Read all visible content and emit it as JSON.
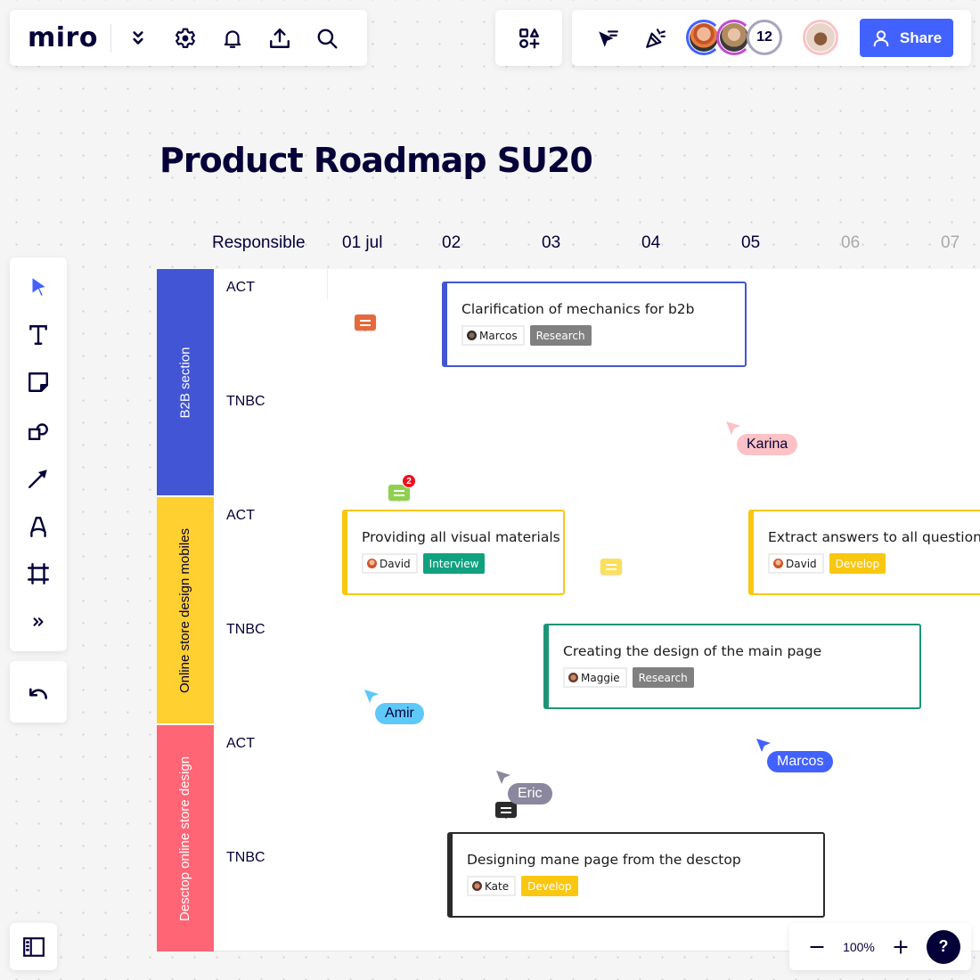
{
  "app": {
    "logo": "miro"
  },
  "topbar": {
    "left_icons": [
      "chevron-double-down-icon",
      "gear-icon",
      "bell-icon",
      "upload-icon",
      "search-icon"
    ],
    "apps_icon": "shapes-plus-icon",
    "collab_icons": [
      "cursor-filter-icon",
      "celebration-icon"
    ],
    "participants_extra_count": "12",
    "share_label": "Share",
    "colors": {
      "share": "#4262ff",
      "avatar1_ring": "#4262ff",
      "avatar2_ring": "#c14bd1",
      "count_ring": "#a7a4bd",
      "me_ring": "#fcc2c5"
    }
  },
  "toolbar": {
    "tools": [
      {
        "name": "select-tool",
        "icon": "pointer-icon"
      },
      {
        "name": "text-tool",
        "icon": "text-icon"
      },
      {
        "name": "sticky-note-tool",
        "icon": "sticky-note-icon"
      },
      {
        "name": "shapes-tool",
        "icon": "shapes-icon"
      },
      {
        "name": "arrow-tool",
        "icon": "arrow-icon"
      },
      {
        "name": "pen-tool",
        "icon": "pen-icon"
      },
      {
        "name": "frame-tool",
        "icon": "frame-icon"
      },
      {
        "name": "more-tools",
        "icon": "chevrons-right-icon"
      }
    ],
    "undo_icon": "undo-icon"
  },
  "board": {
    "title": "Product Roadmap SU20",
    "columns": [
      {
        "label": "Responsible",
        "muted": false
      },
      {
        "label": "01 jul",
        "muted": false
      },
      {
        "label": "02",
        "muted": false
      },
      {
        "label": "03",
        "muted": false
      },
      {
        "label": "04",
        "muted": false
      },
      {
        "label": "05",
        "muted": false
      },
      {
        "label": "06",
        "muted": true
      },
      {
        "label": "07",
        "muted": true
      }
    ],
    "sections": [
      {
        "label": "B2B section",
        "color": "#4255d4",
        "text_color": "#ffffff",
        "rows": [
          "ACT",
          "TNBC"
        ]
      },
      {
        "label": "Online store design mobiles",
        "color": "#ffd02f",
        "text_color": "#050038",
        "rows": [
          "ACT",
          "TNBC"
        ]
      },
      {
        "label": "Desctop online store design",
        "color": "#ff6575",
        "text_color": "#ffffff",
        "rows": [
          "ACT",
          "TNBC"
        ]
      }
    ],
    "cards": [
      {
        "title": "Clarification of mechanics for b2b",
        "person": "Marcos",
        "status": "Research",
        "border": "#4255d4",
        "status_color": "#808080"
      },
      {
        "title": "Providing all visual materials",
        "person": "David",
        "status": "Interview",
        "border": "#fac710",
        "status_color": "#12a17f"
      },
      {
        "title": "Extract answers to all questions",
        "person": "David",
        "status": "Develop",
        "border": "#fac710",
        "status_color": "#fac710"
      },
      {
        "title": "Creating the design of the main page",
        "person": "Maggie",
        "status": "Research",
        "border": "#1d9576",
        "status_color": "#808080"
      },
      {
        "title": "Designing mane page from the desctop",
        "person": "Kate",
        "status": "Develop",
        "border": "#2b2b2b",
        "status_color": "#fac710"
      }
    ],
    "comments": [
      {
        "color": "#e6683c",
        "badge": null
      },
      {
        "color": "#8fd14f",
        "badge": "2"
      },
      {
        "color": "#fddf58",
        "badge": null
      },
      {
        "color": "#2b2b2b",
        "badge": null
      }
    ],
    "cursors": [
      {
        "name": "Karina",
        "color": "#fcc2c5",
        "text_color": "#050038"
      },
      {
        "name": "Amir",
        "color": "#5ec8f8",
        "text_color": "#050038"
      },
      {
        "name": "Marcos",
        "color": "#4262ff",
        "text_color": "#ffffff"
      },
      {
        "name": "Eric",
        "color": "#8a879e",
        "text_color": "#ffffff"
      }
    ]
  },
  "bottombar": {
    "frames_icon": "frames-list-icon",
    "zoom_out_icon": "minus-icon",
    "zoom_level": "100%",
    "zoom_in_icon": "plus-icon",
    "help_label": "?"
  }
}
